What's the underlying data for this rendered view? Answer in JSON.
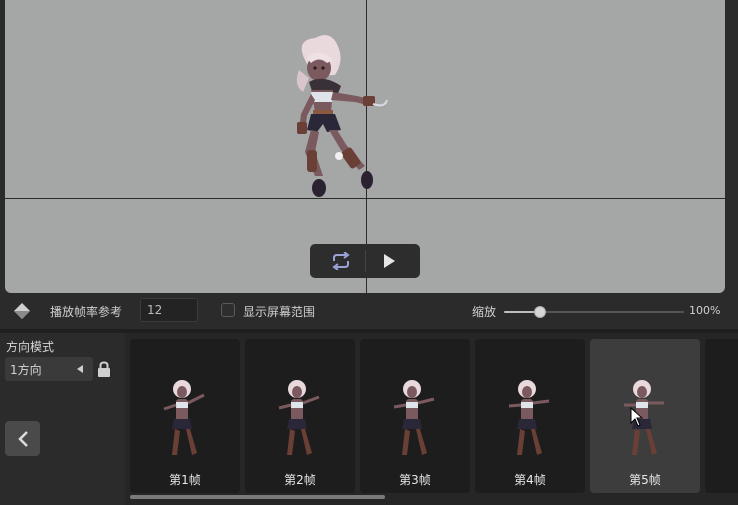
{
  "playback": {
    "loop_icon": "loop-icon",
    "play_icon": "play-icon"
  },
  "toolbar": {
    "fill_icon": "paint-bucket-icon",
    "fps_label": "播放帧率参考",
    "fps_value": "12",
    "show_screen_label": "显示屏幕范围",
    "show_screen_checked": false,
    "zoom_label": "缩放",
    "zoom_value": "100%",
    "zoom_level": 0.2
  },
  "direction": {
    "title": "方向模式",
    "selected": "1方向",
    "lock_icon": "lock-icon",
    "back_icon": "chevron-left-icon"
  },
  "frames": [
    {
      "label": "第1帧",
      "active": false
    },
    {
      "label": "第2帧",
      "active": false
    },
    {
      "label": "第3帧",
      "active": false
    },
    {
      "label": "第4帧",
      "active": false
    },
    {
      "label": "第5帧",
      "active": true
    }
  ],
  "colors": {
    "accent": "#d6d6d6",
    "viewport": "#a5a6a6",
    "active_frame": "#3d3d3d"
  }
}
